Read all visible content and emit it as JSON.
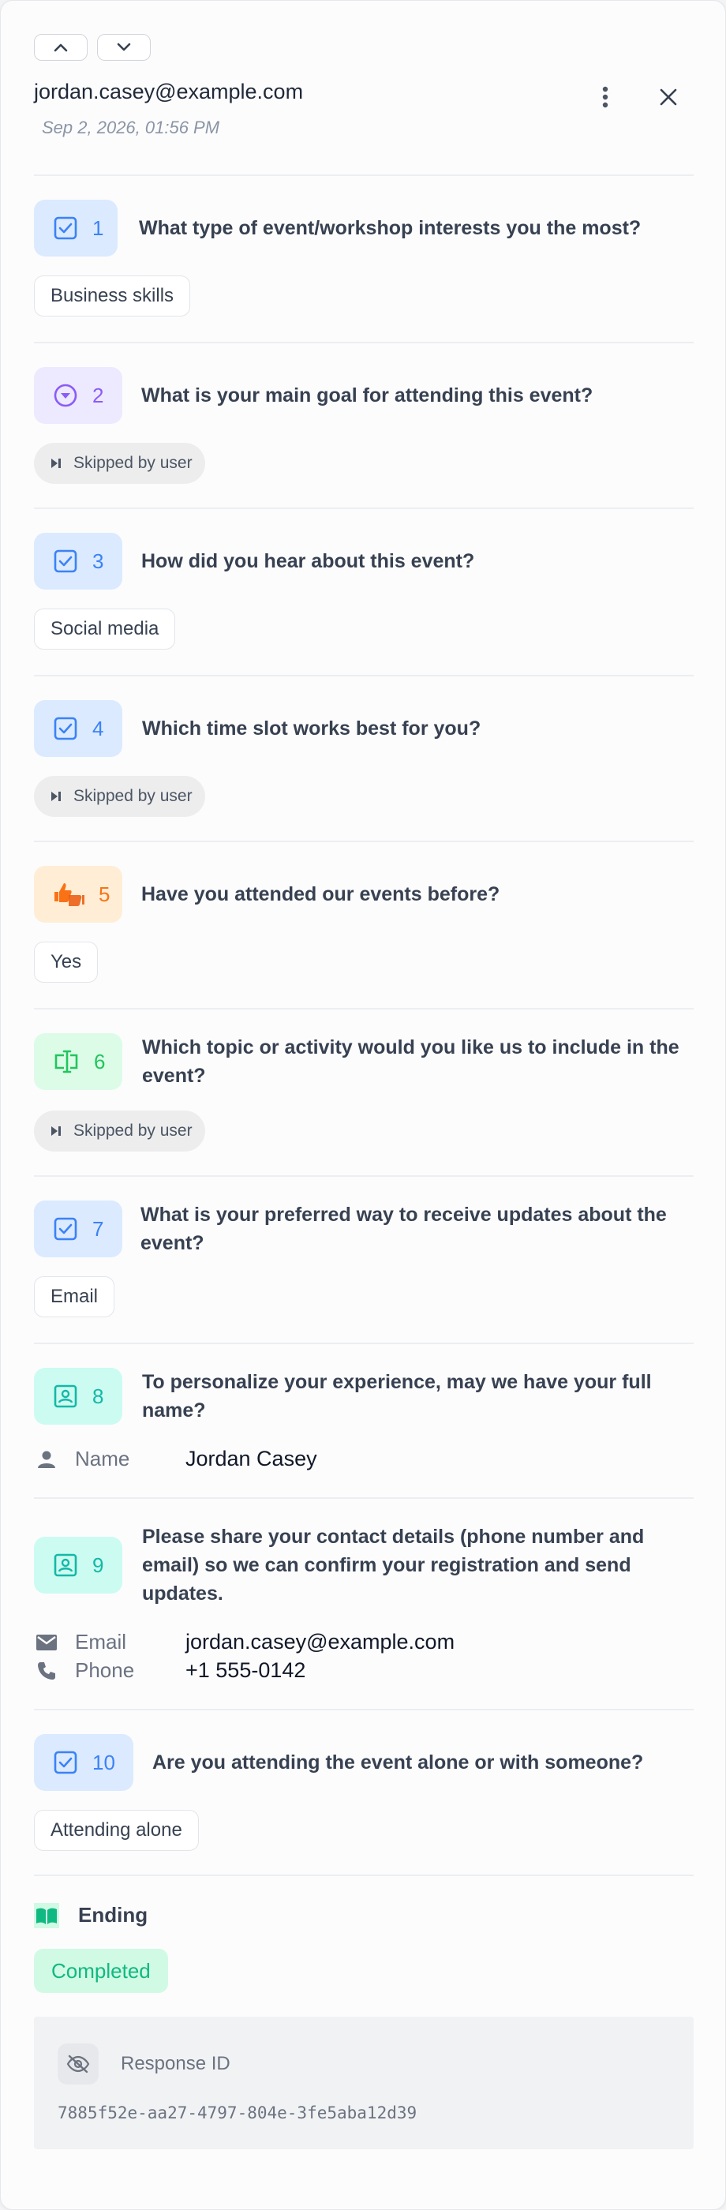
{
  "header": {
    "respondent_email": "jordan.casey@example.com",
    "submitted_at": "Sep 2, 2026, 01:56 PM",
    "icons": {
      "prev": "chevron-up-icon",
      "next": "chevron-down-icon",
      "more": "more-vertical-icon",
      "close": "close-icon"
    }
  },
  "colors": {
    "choice_bg": "#dbeafe",
    "choice_fg": "#3b82f6",
    "dropdown_bg": "#ede9fe",
    "dropdown_fg": "#8b5cf6",
    "yesno_bg": "#ffedd5",
    "yesno_fg": "#f97316",
    "text_bg": "#dcfce7",
    "text_fg": "#22c55e",
    "contact_bg": "#ccfbf1",
    "contact_fg": "#14b8a6",
    "completed_bg": "#d1fae5",
    "completed_fg": "#10b981"
  },
  "questions": [
    {
      "number": "1",
      "icon": "checkbox-icon",
      "text": "What type of event/workshop interests you the most?",
      "answer": "Business skills"
    },
    {
      "number": "2",
      "icon": "dropdown-circle-icon",
      "text": "What is your main goal for attending this event?",
      "answer": "Skipped by user"
    },
    {
      "number": "3",
      "icon": "checkbox-icon",
      "text": "How did you hear about this event?",
      "answer": "Social media"
    },
    {
      "number": "4",
      "icon": "checkbox-icon",
      "text": "Which time slot works best for you?",
      "answer": "Skipped by user"
    },
    {
      "number": "5",
      "icon": "thumbs-icon",
      "text": "Have you attended our events before?",
      "answer": "Yes"
    },
    {
      "number": "6",
      "icon": "text-input-icon",
      "text": "Which topic or activity would you like us to include in the event?",
      "answer": "Skipped by user"
    },
    {
      "number": "7",
      "icon": "checkbox-icon",
      "text": "What is your preferred way to receive updates about the event?",
      "answer": "Email"
    },
    {
      "number": "8",
      "icon": "contact-card-icon",
      "text": "To personalize your experience, may we have your full name?",
      "fields": [
        {
          "label": "Name",
          "value": "Jordan Casey",
          "icon": "person-icon"
        }
      ]
    },
    {
      "number": "9",
      "icon": "contact-card-icon",
      "text": "Please share your contact details (phone number and email) so we can confirm your registration and send updates.",
      "fields": [
        {
          "label": "Email",
          "value": "jordan.casey@example.com",
          "icon": "mail-icon"
        },
        {
          "label": "Phone",
          "value": "+1 555-0142",
          "icon": "phone-icon"
        }
      ]
    },
    {
      "number": "10",
      "icon": "checkbox-icon",
      "text": "Are you attending the event alone or with someone?",
      "answer": "Attending alone"
    }
  ],
  "skip_icon": "skip-forward-icon",
  "ending": {
    "label": "Ending",
    "icon": "book-open-icon",
    "status": "Completed"
  },
  "response": {
    "label": "Response ID",
    "icon": "eye-off-icon",
    "id": "7885f52e-aa27-4797-804e-3fe5aba12d39"
  }
}
